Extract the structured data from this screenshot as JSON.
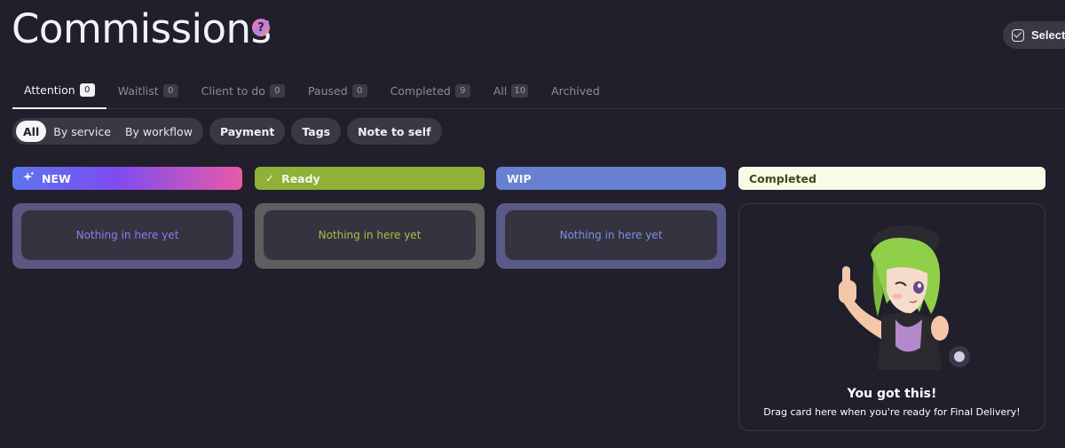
{
  "header": {
    "title": "Commissions",
    "help_label": "?",
    "select_label": "Select"
  },
  "tabs": [
    {
      "label": "Attention",
      "count": "0",
      "active": true
    },
    {
      "label": "Waitlist",
      "count": "0"
    },
    {
      "label": "Client to do",
      "count": "0"
    },
    {
      "label": "Paused",
      "count": "0"
    },
    {
      "label": "Completed",
      "count": "9"
    },
    {
      "label": "All",
      "count": "10"
    },
    {
      "label": "Archived",
      "count": null
    }
  ],
  "filters": {
    "segmented": [
      "All",
      "By service",
      "By workflow"
    ],
    "selected": "All",
    "pills": [
      "Payment",
      "Tags",
      "Note to self"
    ]
  },
  "columns": {
    "new": {
      "label": "NEW",
      "icon": "sparkle-icon",
      "empty_text": "Nothing in here yet"
    },
    "ready": {
      "label": "Ready",
      "icon": "check-icon",
      "empty_text": "Nothing in here yet"
    },
    "wip": {
      "label": "WIP",
      "empty_text": "Nothing in here yet"
    },
    "completed": {
      "label": "Completed",
      "title": "You got this!",
      "subtitle": "Drag card here when you're ready for Final Delivery!",
      "icon": "thumbs-up-mascot"
    }
  },
  "colors": {
    "background": "#211f2b",
    "ready": "#8fb137",
    "wip": "#6880d0",
    "completed_header": "#fafbe6"
  }
}
